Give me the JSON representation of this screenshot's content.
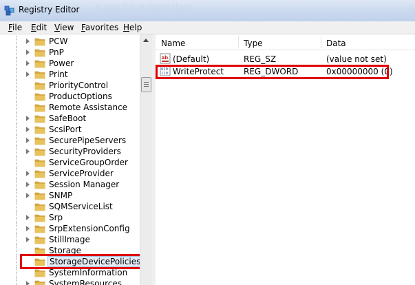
{
  "window": {
    "title": "Registry Editor",
    "ghost_text": "h and if it is there then"
  },
  "menu": [
    "File",
    "Edit",
    "View",
    "Favorites",
    "Help"
  ],
  "tree": {
    "items": [
      {
        "label": "PCW",
        "expandable": true
      },
      {
        "label": "PnP",
        "expandable": true
      },
      {
        "label": "Power",
        "expandable": true
      },
      {
        "label": "Print",
        "expandable": true
      },
      {
        "label": "PriorityControl",
        "expandable": false
      },
      {
        "label": "ProductOptions",
        "expandable": false
      },
      {
        "label": "Remote Assistance",
        "expandable": false
      },
      {
        "label": "SafeBoot",
        "expandable": true
      },
      {
        "label": "ScsiPort",
        "expandable": true
      },
      {
        "label": "SecurePipeServers",
        "expandable": true
      },
      {
        "label": "SecurityProviders",
        "expandable": true
      },
      {
        "label": "ServiceGroupOrder",
        "expandable": false
      },
      {
        "label": "ServiceProvider",
        "expandable": true
      },
      {
        "label": "Session Manager",
        "expandable": true
      },
      {
        "label": "SNMP",
        "expandable": true
      },
      {
        "label": "SQMServiceList",
        "expandable": false
      },
      {
        "label": "Srp",
        "expandable": true
      },
      {
        "label": "SrpExtensionConfig",
        "expandable": true
      },
      {
        "label": "StillImage",
        "expandable": true
      },
      {
        "label": "Storage",
        "expandable": false
      },
      {
        "label": "StorageDevicePolicies",
        "expandable": false,
        "selected": true
      },
      {
        "label": "SystemInformation",
        "expandable": false
      },
      {
        "label": "SystemResources",
        "expandable": true
      }
    ]
  },
  "list": {
    "columns": [
      "Name",
      "Type",
      "Data"
    ],
    "rows": [
      {
        "name": "(Default)",
        "type": "REG_SZ",
        "data": "(value not set)",
        "icon": "string-value-icon"
      },
      {
        "name": "WriteProtect",
        "type": "REG_DWORD",
        "data": "0x00000000 (0)",
        "icon": "dword-value-icon",
        "highlighted": true
      }
    ]
  },
  "colors": {
    "highlight_box": "#e00000",
    "folder": "#e8c25a",
    "selection": "#e3ebf6"
  }
}
